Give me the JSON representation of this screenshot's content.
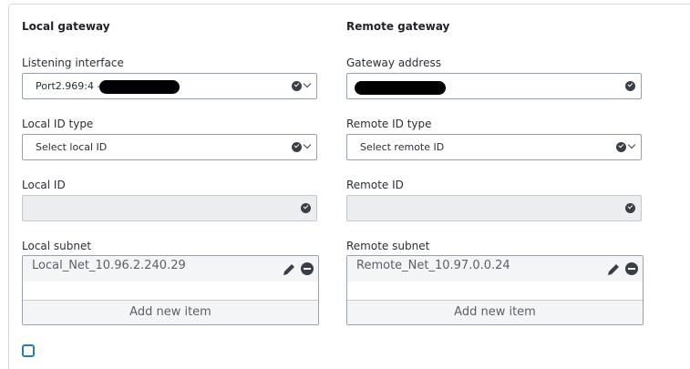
{
  "local": {
    "title": "Local gateway",
    "listening_interface": {
      "label": "Listening interface",
      "value": "Port2.969:4 -"
    },
    "id_type": {
      "label": "Local ID type",
      "value": "Select local ID"
    },
    "id": {
      "label": "Local ID",
      "value": ""
    },
    "subnet": {
      "label": "Local subnet",
      "items": [
        "Local_Net_10.96.2.240.29"
      ],
      "add_label": "Add new item"
    }
  },
  "remote": {
    "title": "Remote gateway",
    "gateway_address": {
      "label": "Gateway address",
      "value": ""
    },
    "id_type": {
      "label": "Remote ID type",
      "value": "Select remote ID"
    },
    "id": {
      "label": "Remote ID",
      "value": ""
    },
    "subnet": {
      "label": "Remote subnet",
      "items": [
        "Remote_Net_10.97.0.0.24"
      ],
      "add_label": "Add new item"
    }
  },
  "colors": {
    "border": "#9aa1ab",
    "disabled_bg": "#ebedef",
    "icon": "#3a3f47",
    "checkbox": "#2a7ab8"
  },
  "icons": [
    "check-circle-icon",
    "chevron-down-icon",
    "pencil-icon",
    "minus-circle-icon"
  ]
}
